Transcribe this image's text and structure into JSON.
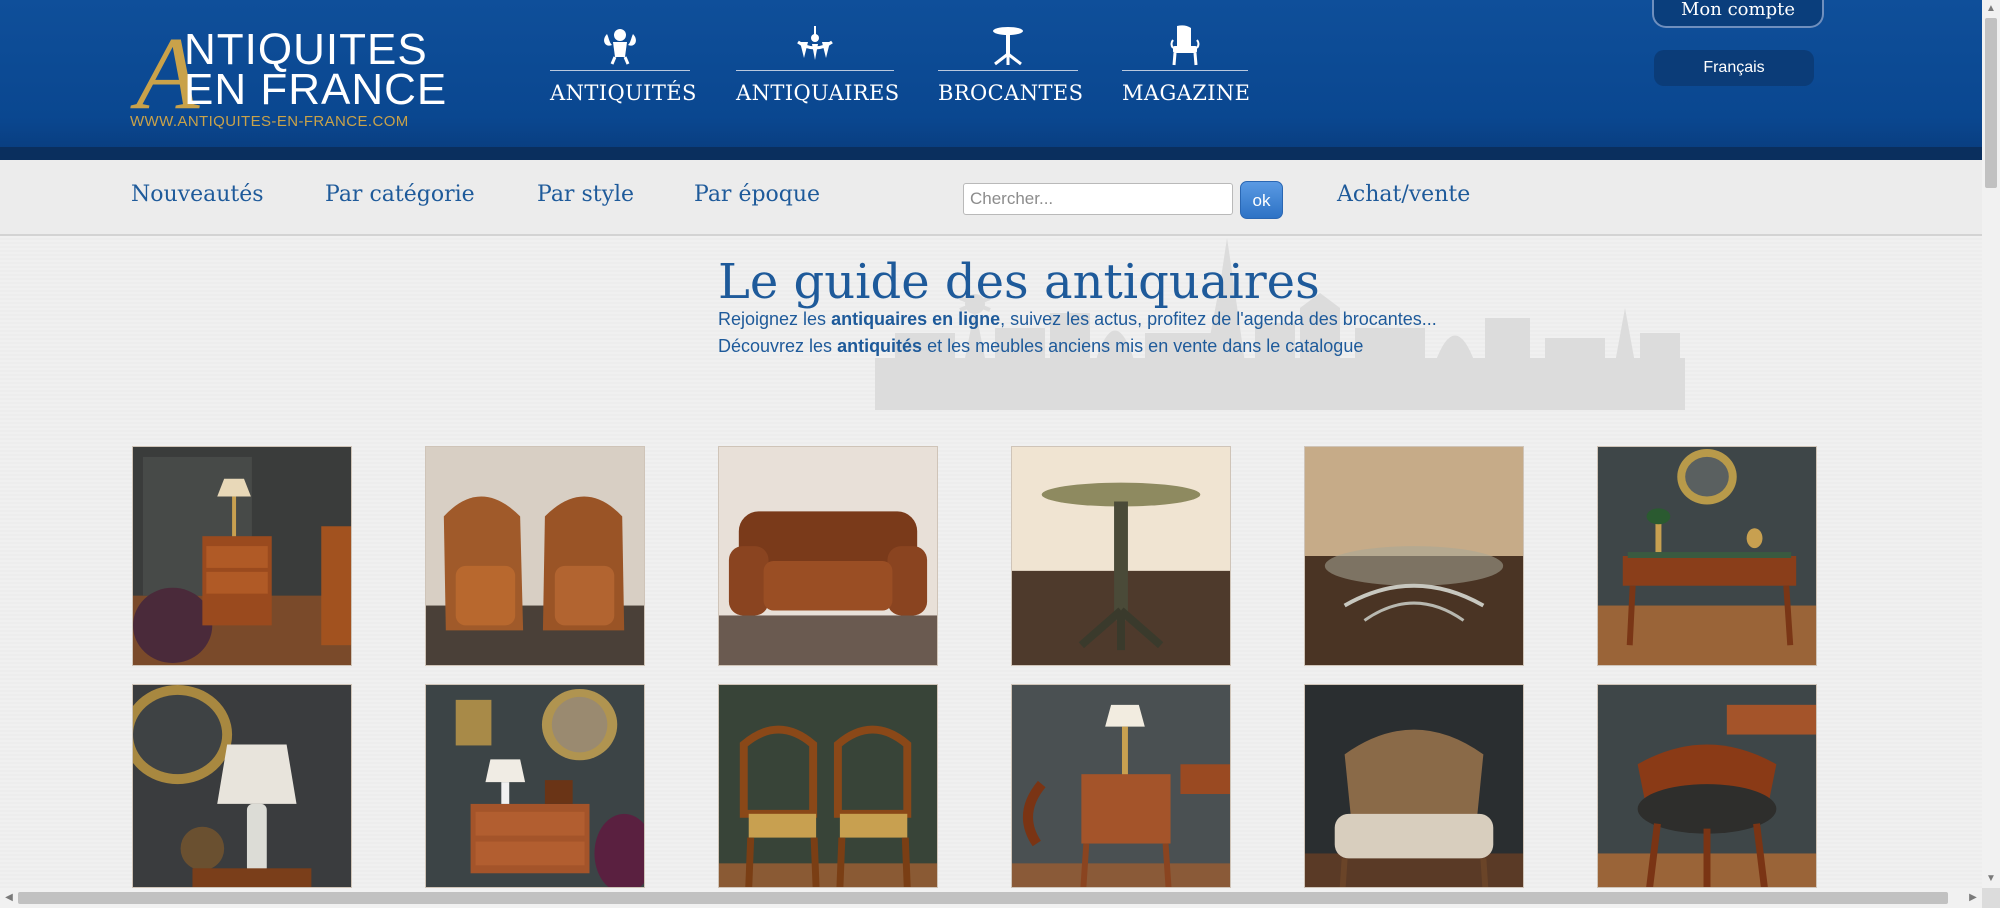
{
  "header": {
    "logo": {
      "line1": "NTIQUITES",
      "initial": "A",
      "line2": "EN FRANCE",
      "url": "WWW.ANTIQUITES-EN-FRANCE.COM"
    },
    "nav": [
      {
        "label": "ANTIQUITÉS",
        "icon": "cherub-icon"
      },
      {
        "label": "ANTIQUAIRES",
        "icon": "chandelier-icon"
      },
      {
        "label": "BROCANTES",
        "icon": "pedestal-table-icon"
      },
      {
        "label": "MAGAZINE",
        "icon": "chair-icon"
      }
    ],
    "account_label": "Mon compte",
    "language_label": "Français"
  },
  "subnav": {
    "items": [
      "Nouveautés",
      "Par catégorie",
      "Par style",
      "Par époque"
    ],
    "search_placeholder": "Chercher...",
    "search_button": "ok",
    "buy_sell": "Achat/vente"
  },
  "intro": {
    "title": "Le guide des antiquaires",
    "line1_a": "Rejoignez les ",
    "line1_b": "antiquaires en ligne",
    "line1_c": ", suivez les actus, profitez de l'agenda des brocantes...",
    "line2_a": "Découvrez les ",
    "line2_b": "antiquités",
    "line2_c": " et les meubles anciens mis en vente dans le catalogue"
  },
  "colors": {
    "header_blue": "#0f4f9a",
    "gold": "#c9a24a",
    "link_blue": "#1e5a9a"
  },
  "gallery": [
    {
      "name": "nightstand-with-lamp"
    },
    {
      "name": "pair-of-leather-club-chairs"
    },
    {
      "name": "leather-sofa"
    },
    {
      "name": "pedestal-table"
    },
    {
      "name": "glass-coffee-table"
    },
    {
      "name": "writing-desk"
    },
    {
      "name": "globe-and-lamp"
    },
    {
      "name": "chest-of-drawers"
    },
    {
      "name": "pair-of-rush-chairs"
    },
    {
      "name": "small-side-table"
    },
    {
      "name": "upholstered-armchair"
    },
    {
      "name": "office-armchair"
    }
  ]
}
